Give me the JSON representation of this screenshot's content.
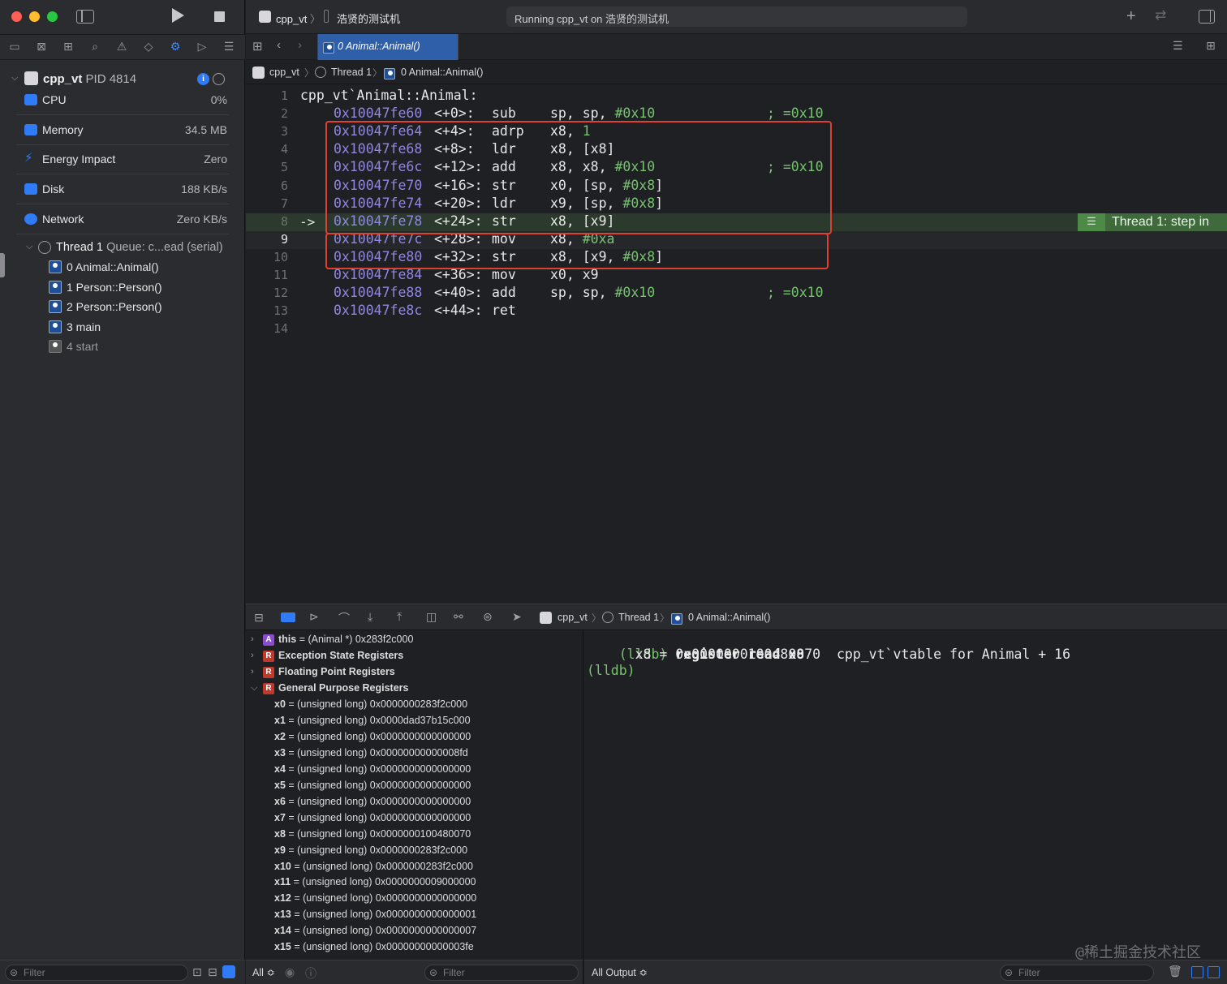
{
  "toolbar": {
    "scheme": "cpp_vt",
    "device": "浩贤的测试机",
    "status": "Running cpp_vt on 浩贤的测试机"
  },
  "tab": {
    "label": "0 Animal::Animal()"
  },
  "jumpbar": {
    "items": [
      "cpp_vt",
      "Thread 1",
      "0 Animal::Animal()"
    ]
  },
  "process": {
    "name": "cpp_vt",
    "pid": "PID 4814"
  },
  "gauges": [
    {
      "label": "CPU",
      "value": "0%"
    },
    {
      "label": "Memory",
      "value": "34.5 MB"
    },
    {
      "label": "Energy Impact",
      "value": "Zero"
    },
    {
      "label": "Disk",
      "value": "188 KB/s"
    },
    {
      "label": "Network",
      "value": "Zero KB/s"
    }
  ],
  "thread": {
    "name": "Thread 1",
    "queue": "Queue: c...ead (serial)"
  },
  "frames": [
    "0 Animal::Animal()",
    "1 Person::Person()",
    "2 Person::Person()",
    "3 main",
    "4 start"
  ],
  "code": [
    {
      "n": "1",
      "text": "cpp_vt`Animal::Animal:"
    },
    {
      "n": "2",
      "addr": "0x10047fe60",
      "off": "<+0>:",
      "op": "sub",
      "args": [
        "sp, sp, ",
        "#0x10"
      ],
      "cmt": "; =0x10"
    },
    {
      "n": "3",
      "addr": "0x10047fe64",
      "off": "<+4>:",
      "op": "adrp",
      "args": [
        "x8, ",
        "1"
      ],
      "cmt": ""
    },
    {
      "n": "4",
      "addr": "0x10047fe68",
      "off": "<+8>:",
      "op": "ldr",
      "args": [
        "x8, [x8]",
        ""
      ],
      "cmt": ""
    },
    {
      "n": "5",
      "addr": "0x10047fe6c",
      "off": "<+12>:",
      "op": "add",
      "args": [
        "x8, x8, ",
        "#0x10"
      ],
      "cmt": "; =0x10"
    },
    {
      "n": "6",
      "addr": "0x10047fe70",
      "off": "<+16>:",
      "op": "str",
      "args": [
        "x0, [sp, ",
        "#0x8",
        "]"
      ],
      "cmt": ""
    },
    {
      "n": "7",
      "addr": "0x10047fe74",
      "off": "<+20>:",
      "op": "ldr",
      "args": [
        "x9, [sp, ",
        "#0x8",
        "]"
      ],
      "cmt": ""
    },
    {
      "n": "8",
      "addr": "0x10047fe78",
      "off": "<+24>:",
      "op": "str",
      "args": [
        "x8, [x9]",
        ""
      ],
      "cmt": ""
    },
    {
      "n": "9",
      "addr": "0x10047fe7c",
      "off": "<+28>:",
      "op": "mov",
      "args": [
        "x8, ",
        "#0xa"
      ],
      "cmt": ""
    },
    {
      "n": "10",
      "addr": "0x10047fe80",
      "off": "<+32>:",
      "op": "str",
      "args": [
        "x8, [x9, ",
        "#0x8",
        "]"
      ],
      "cmt": ""
    },
    {
      "n": "11",
      "addr": "0x10047fe84",
      "off": "<+36>:",
      "op": "mov",
      "args": [
        "x0, x9",
        ""
      ],
      "cmt": ""
    },
    {
      "n": "12",
      "addr": "0x10047fe88",
      "off": "<+40>:",
      "op": "add",
      "args": [
        "sp, sp, ",
        "#0x10"
      ],
      "cmt": "; =0x10"
    },
    {
      "n": "13",
      "addr": "0x10047fe8c",
      "off": "<+44>:",
      "op": "ret",
      "args": [
        "",
        ""
      ],
      "cmt": ""
    },
    {
      "n": "14",
      "text": ""
    }
  ],
  "pc_arrow": "->",
  "thread_badge": "Thread 1: step in",
  "debugbar": {
    "jump": [
      "cpp_vt",
      "Thread 1",
      "0 Animal::Animal()"
    ]
  },
  "variables": [
    {
      "badge": "A",
      "name": "this",
      "value": " = (Animal *) 0x283f2c000"
    },
    {
      "badge": "R",
      "name": "Exception State Registers",
      "value": ""
    },
    {
      "badge": "R",
      "name": "Floating Point Registers",
      "value": ""
    },
    {
      "badge": "R",
      "name": "General Purpose Registers",
      "value": ""
    }
  ],
  "registers": [
    {
      "name": "x0",
      "value": " = (unsigned long) 0x0000000283f2c000"
    },
    {
      "name": "x1",
      "value": " = (unsigned long) 0x0000dad37b15c000"
    },
    {
      "name": "x2",
      "value": " = (unsigned long) 0x0000000000000000"
    },
    {
      "name": "x3",
      "value": " = (unsigned long) 0x00000000000008fd"
    },
    {
      "name": "x4",
      "value": " = (unsigned long) 0x0000000000000000"
    },
    {
      "name": "x5",
      "value": " = (unsigned long) 0x0000000000000000"
    },
    {
      "name": "x6",
      "value": " = (unsigned long) 0x0000000000000000"
    },
    {
      "name": "x7",
      "value": " = (unsigned long) 0x0000000000000000"
    },
    {
      "name": "x8",
      "value": " = (unsigned long) 0x0000000100480070"
    },
    {
      "name": "x9",
      "value": " = (unsigned long) 0x0000000283f2c000"
    },
    {
      "name": "x10",
      "value": " = (unsigned long) 0x0000000283f2c000"
    },
    {
      "name": "x11",
      "value": " = (unsigned long) 0x0000000009000000"
    },
    {
      "name": "x12",
      "value": " = (unsigned long) 0x0000000000000000"
    },
    {
      "name": "x13",
      "value": " = (unsigned long) 0x0000000000000001"
    },
    {
      "name": "x14",
      "value": " = (unsigned long) 0x0000000000000007"
    },
    {
      "name": "x15",
      "value": " = (unsigned long) 0x00000000000003fe"
    }
  ],
  "console": {
    "prompt": "(lldb)",
    "command": "register read x8",
    "output": "      x8 = 0x0000000100480070  cpp_vt`vtable for Animal + 16"
  },
  "filters": {
    "sidebar": "Filter",
    "vars_scope": "All ≎",
    "vars": "Filter",
    "console_scope": "All Output ≎",
    "console": "Filter"
  },
  "watermark": "@稀土掘金技术社区",
  "colors": {
    "accent": "#2f7cf6",
    "highlight_box": "#e0402e",
    "pc_line": "#2b3a2d",
    "address": "#8f87e0",
    "number": "#76c46e"
  }
}
